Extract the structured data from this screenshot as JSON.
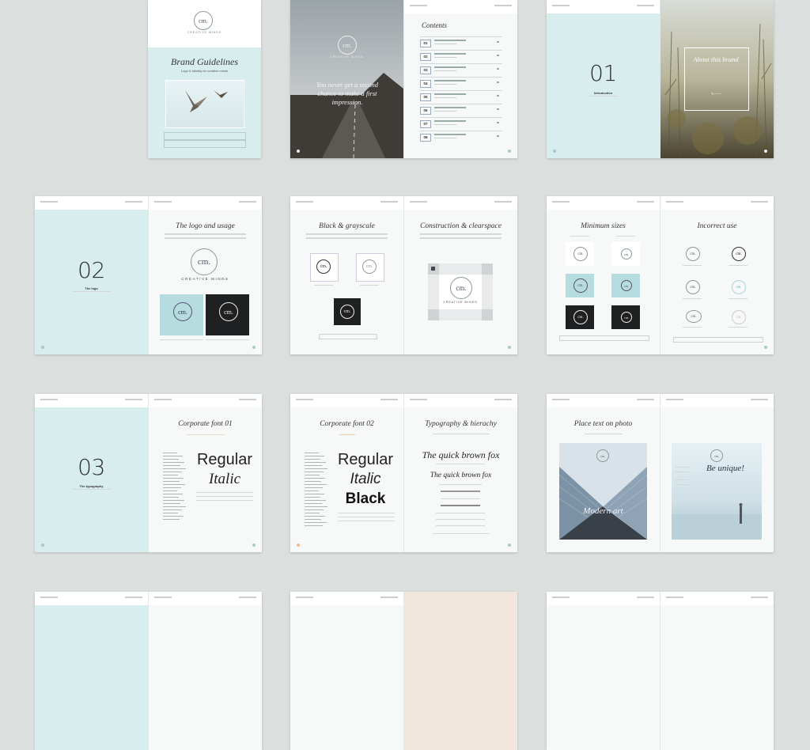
{
  "brand": {
    "logo_text": "cm.",
    "logo_sub": "CREATIVE MINDS"
  },
  "cover": {
    "title": "Brand Guidelines",
    "subtitle": "Logo & identity for creative minds"
  },
  "spread1": {
    "quote": "You never get a second chance to make a first impression.",
    "contents_title": "Contents",
    "contents_numbers": [
      "01",
      "02",
      "03",
      "04",
      "05",
      "06",
      "07",
      "08"
    ]
  },
  "spread2": {
    "number": "01",
    "label": "Introduction",
    "about_title": "About this brand"
  },
  "spread3": {
    "number": "02",
    "label": "The logo",
    "right_title": "The logo and usage"
  },
  "spread4": {
    "left_title": "Black & grayscale",
    "right_title": "Construction & clearspace"
  },
  "spread5": {
    "left_title": "Minimum sizes",
    "right_title": "Incorrect use"
  },
  "spread6": {
    "number": "03",
    "label": "The typography",
    "right_title": "Corporate font 01",
    "regular": "Regular",
    "italic": "Italic"
  },
  "spread7": {
    "left_title": "Corporate font 02",
    "regular": "Regular",
    "italic": "Italic",
    "black": "Black",
    "right_title": "Typography & hierachy",
    "fox1": "The quick brown fox",
    "fox2": "The quick brown fox"
  },
  "spread8": {
    "left_title": "Place text on photo",
    "photo_left": "Modern art",
    "photo_right": "Be unique!"
  },
  "colors": {
    "mint": "#d8eded",
    "background": "#dbe0de",
    "page": "#f7f8f8"
  }
}
